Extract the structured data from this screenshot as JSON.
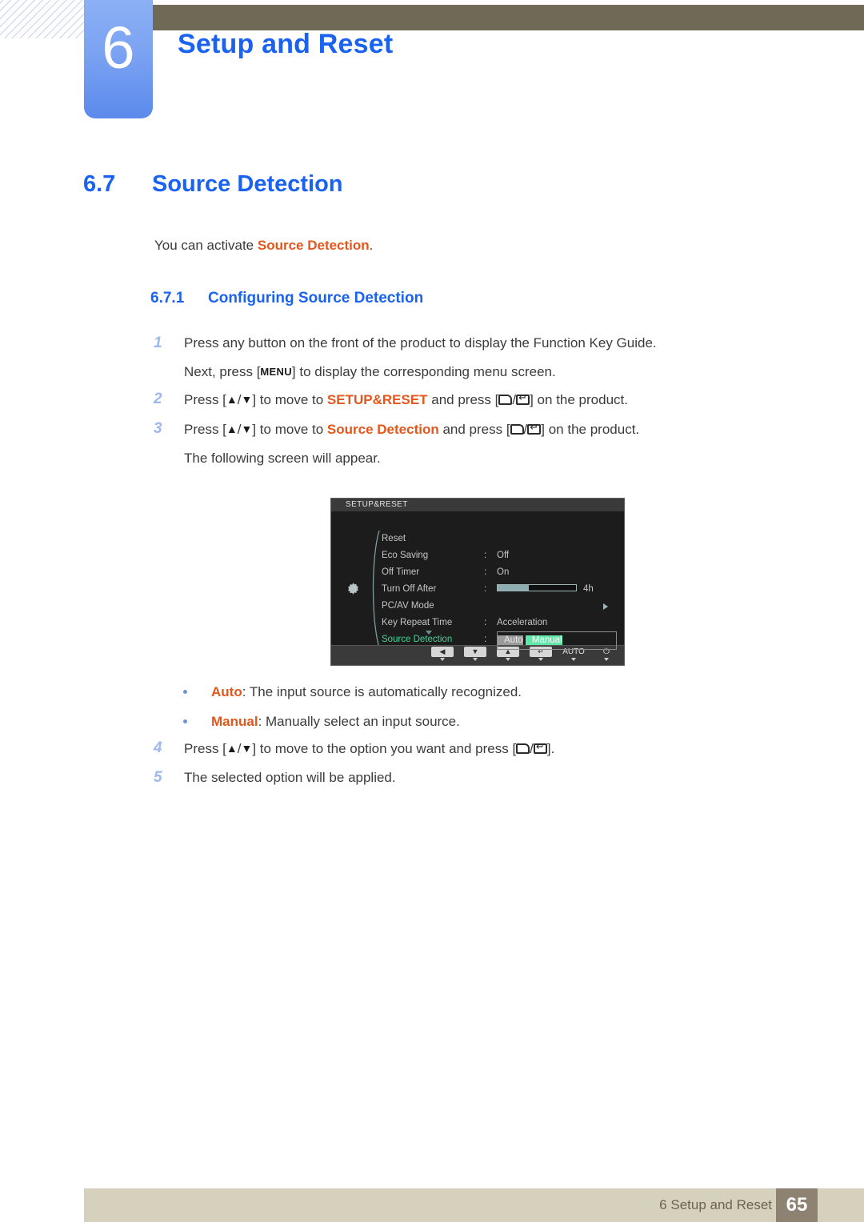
{
  "header": {
    "chapter_number": "6",
    "chapter_title": "Setup and Reset"
  },
  "section": {
    "number": "6.7",
    "title": "Source Detection",
    "intro_before": "You can activate ",
    "intro_highlight": "Source Detection",
    "intro_after": "."
  },
  "subsection": {
    "number": "6.7.1",
    "title": "Configuring Source Detection"
  },
  "steps": {
    "one": {
      "num": "1",
      "text": "Press any button on the front of the product to display the Function Key Guide.",
      "sub_a": "Next, press [",
      "sub_key": "MENU",
      "sub_b": "] to display the corresponding menu screen."
    },
    "two": {
      "num": "2",
      "a": "Press [",
      "up": "▲",
      "slash": "/",
      "down": "▼",
      "b": "] to move to ",
      "target": "SETUP&RESET",
      "c": " and press [",
      "d": "] on the product."
    },
    "three": {
      "num": "3",
      "a": "Press [",
      "b": "] to move to ",
      "target": "Source Detection",
      "c": " and press [",
      "d": "] on the product.",
      "sub": "The following screen will appear."
    },
    "four": {
      "num": "4",
      "a": "Press [",
      "b": "] to move to the option you want and press [",
      "c": "]."
    },
    "five": {
      "num": "5",
      "text": "The selected option will be applied."
    }
  },
  "bullets": [
    {
      "term": "Auto",
      "desc": ": The input source is automatically recognized."
    },
    {
      "term": "Manual",
      "desc": ": Manually select an input source."
    }
  ],
  "osd": {
    "title": "SETUP&RESET",
    "rows": [
      {
        "label": "Reset",
        "colon": "",
        "value": ""
      },
      {
        "label": "Eco Saving",
        "colon": ":",
        "value": "Off"
      },
      {
        "label": "Off Timer",
        "colon": ":",
        "value": "On"
      },
      {
        "label": "Turn Off After",
        "colon": ":",
        "value": "4h",
        "slider_percent": 40
      },
      {
        "label": "PC/AV Mode",
        "colon": "",
        "value": ""
      },
      {
        "label": "Key Repeat Time",
        "colon": ":",
        "value": "Acceleration"
      },
      {
        "label": "Source Detection",
        "colon": ":",
        "value": ""
      }
    ],
    "dropdown": {
      "auto": "Auto",
      "manual": "Manual",
      "selected": "Manual"
    },
    "buttons": [
      {
        "name": "left",
        "glyph": "◀"
      },
      {
        "name": "down",
        "glyph": "▼"
      },
      {
        "name": "up",
        "glyph": "▲"
      },
      {
        "name": "enter",
        "glyph": "↵"
      },
      {
        "name": "auto",
        "glyph": "AUTO"
      },
      {
        "name": "power",
        "glyph": "⏻"
      }
    ],
    "colors": {
      "highlight_green": "#5fe8a8",
      "option_gray": "#9a9a9a",
      "background": "#1c1c1c"
    }
  },
  "footer": {
    "text": "6 Setup and Reset",
    "page": "65"
  },
  "colors": {
    "heading_blue": "#1a62f0",
    "term_orange": "#e4571c",
    "header_bar": "#6e6a55",
    "footer_bar": "#d6d1bd",
    "page_box": "#8e8273"
  }
}
